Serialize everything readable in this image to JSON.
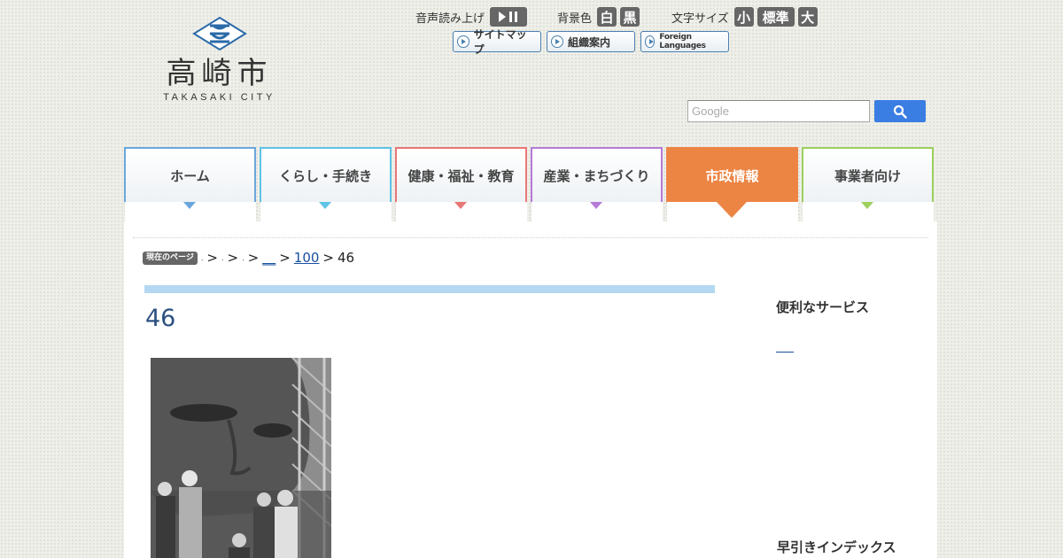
{
  "logo": {
    "name": "高崎市",
    "sub": "TAKASAKI CITY"
  },
  "utility": {
    "voice_label": "音声読み上げ",
    "bg_label": "背景色",
    "bg_white": "白",
    "bg_black": "黒",
    "font_label": "文字サイズ",
    "font_small": "小",
    "font_standard": "標準",
    "font_large": "大",
    "links": [
      "サイトマップ",
      "組織案内",
      "Foreign Languages"
    ]
  },
  "search": {
    "placeholder": "Google"
  },
  "nav": {
    "items": [
      {
        "label": "ホーム",
        "color": "#6aa7dd"
      },
      {
        "label": "くらし・手続き",
        "color": "#5ec3e6"
      },
      {
        "label": "健康・福祉・教育",
        "color": "#e87777"
      },
      {
        "label": "産業・まちづくり",
        "color": "#b57bd6"
      },
      {
        "label": "市政情報",
        "color": "#ec8544"
      },
      {
        "label": "事業者向け",
        "color": "#9bd05c"
      }
    ],
    "active": "市政情報"
  },
  "breadcrumb": {
    "badge": "現在のページ",
    "items": [
      ".",
      ".",
      ".",
      "__",
      "100"
    ],
    "current": "46"
  },
  "page": {
    "title": "46"
  },
  "sidebar": {
    "heading1": "便利なサービス",
    "link1": "__",
    "heading2": "早引きインデックス"
  }
}
